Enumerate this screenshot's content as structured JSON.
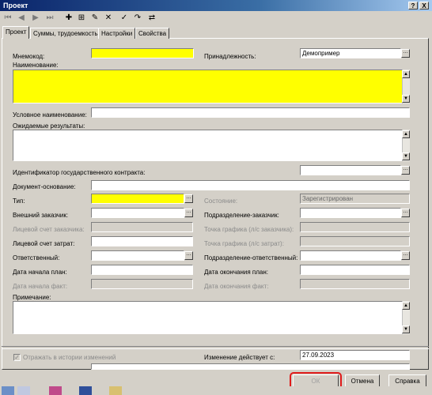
{
  "window": {
    "title": "Проект",
    "help_btn": "?",
    "close_btn": "X"
  },
  "tabs": [
    {
      "label": "Проект",
      "active": true
    },
    {
      "label": "Суммы, трудоемкость"
    },
    {
      "label": "Настройки"
    },
    {
      "label": "Свойства"
    }
  ],
  "form": {
    "mnemocode_label": "Мнемокод:",
    "mnemocode_value": "",
    "belongs_label": "Принадлежность:",
    "belongs_value": "Демопример",
    "name_label": "Наименование:",
    "name_value": "",
    "short_name_label": "Условное наименование:",
    "expected_results_label": "Ожидаемые результаты:",
    "contract_id_label": "Идентификатор государственного контракта:",
    "basis_doc_label": "Документ-основание:",
    "type_label": "Тип:",
    "state_label": "Состояние:",
    "state_value": "Зарегистрирован",
    "external_customer_label": "Внешний заказчик:",
    "customer_dept_label": "Подразделение-заказчик:",
    "customer_account_label": "Лицевой счет заказчика:",
    "schedule_point_customer_label": "Точка графика (л/с заказчика):",
    "cost_account_label": "Лицевой счет затрат:",
    "schedule_point_cost_label": "Точка графика (л/с затрат):",
    "responsible_label": "Ответственный:",
    "responsible_dept_label": "Подразделение-ответственный:",
    "start_plan_label": "Дата начала план:",
    "end_plan_label": "Дата окончания план:",
    "start_fact_label": "Дата начала факт:",
    "end_fact_label": "Дата окончания факт:",
    "note_label": "Примечание:",
    "history_checkbox_label": "Отражать в истории изменений",
    "history_checked": true,
    "change_effective_label": "Изменение действует с:",
    "change_effective_value": "27.09.2023"
  },
  "buttons": {
    "ok": "ОК",
    "cancel": "Отмена",
    "help": "Справка"
  },
  "colors": {
    "required_field": "#ffff00",
    "highlight_ring": "#e01b1b",
    "titlebar": "#0a246a"
  }
}
